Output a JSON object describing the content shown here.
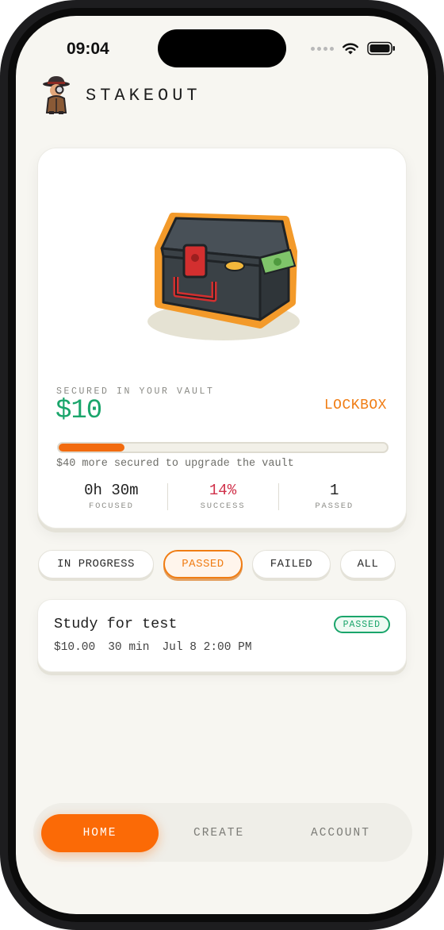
{
  "status_bar": {
    "time": "09:04"
  },
  "app": {
    "title": "STAKEOUT"
  },
  "vault": {
    "caption": "SECURED IN YOUR VAULT",
    "amount": "$10",
    "tier": "LOCKBOX",
    "progress_fraction": 0.2,
    "progress_hint": "$40 more secured to upgrade the vault",
    "stats": [
      {
        "value": "0h 30m",
        "label": "FOCUSED"
      },
      {
        "value": "14%",
        "label": "SUCCESS"
      },
      {
        "value": "1",
        "label": "PASSED"
      }
    ]
  },
  "filters": {
    "in_progress": "IN PROGRESS",
    "passed": "PASSED",
    "failed": "FAILED",
    "all": "ALL",
    "selected": "PASSED"
  },
  "tasks": [
    {
      "title": "Study for test",
      "status": "PASSED",
      "stake": "$10.00",
      "duration": "30 min",
      "date": "Jul 8 2:00 PM"
    }
  ],
  "nav": {
    "home": "HOME",
    "create": "CREATE",
    "account": "ACCOUNT",
    "active": "HOME"
  },
  "colors": {
    "accent": "#f26b0f",
    "money_green": "#1aa56b",
    "success_red": "#d0314a",
    "background": "#f7f6f1"
  },
  "icons": [
    "signal-dots-icon",
    "wifi-icon",
    "battery-icon",
    "detective-logo-icon",
    "lockbox-icon"
  ]
}
